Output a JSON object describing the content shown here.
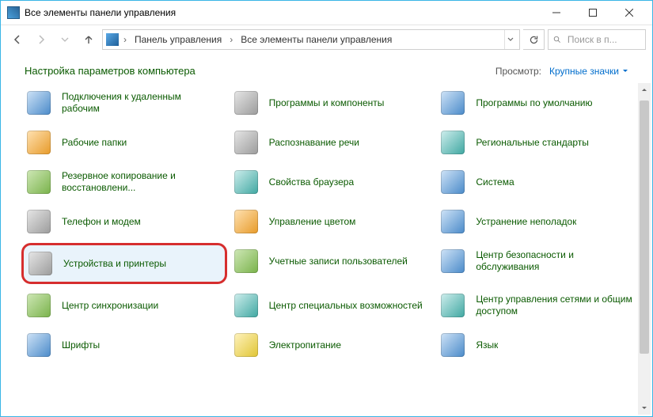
{
  "window": {
    "title": "Все элементы панели управления"
  },
  "breadcrumb": {
    "segments": [
      "Панель управления",
      "Все элементы панели управления"
    ]
  },
  "search": {
    "placeholder": "Поиск в п..."
  },
  "header": {
    "heading": "Настройка параметров компьютера",
    "view_label": "Просмотр:",
    "view_value": "Крупные значки"
  },
  "items": [
    {
      "label": "Подключения к удаленным рабочим",
      "icon": "blue",
      "highlight": false
    },
    {
      "label": "Программы и компоненты",
      "icon": "gray",
      "highlight": false
    },
    {
      "label": "Программы по умолчанию",
      "icon": "blue",
      "highlight": false
    },
    {
      "label": "Рабочие папки",
      "icon": "orange",
      "highlight": false
    },
    {
      "label": "Распознавание речи",
      "icon": "gray",
      "highlight": false
    },
    {
      "label": "Региональные стандарты",
      "icon": "teal",
      "highlight": false
    },
    {
      "label": "Резервное копирование и восстановлени...",
      "icon": "green",
      "highlight": false
    },
    {
      "label": "Свойства браузера",
      "icon": "teal",
      "highlight": false
    },
    {
      "label": "Система",
      "icon": "blue",
      "highlight": false
    },
    {
      "label": "Телефон и модем",
      "icon": "gray",
      "highlight": false
    },
    {
      "label": "Управление цветом",
      "icon": "orange",
      "highlight": false
    },
    {
      "label": "Устранение неполадок",
      "icon": "blue",
      "highlight": false
    },
    {
      "label": "Устройства и принтеры",
      "icon": "gray",
      "highlight": true
    },
    {
      "label": "Учетные записи пользователей",
      "icon": "green",
      "highlight": false
    },
    {
      "label": "Центр безопасности и обслуживания",
      "icon": "blue",
      "highlight": false
    },
    {
      "label": "Центр синхронизации",
      "icon": "green",
      "highlight": false
    },
    {
      "label": "Центр специальных возможностей",
      "icon": "teal",
      "highlight": false
    },
    {
      "label": "Центр управления сетями и общим доступом",
      "icon": "teal",
      "highlight": false
    },
    {
      "label": "Шрифты",
      "icon": "blue",
      "highlight": false
    },
    {
      "label": "Электропитание",
      "icon": "yellow",
      "highlight": false
    },
    {
      "label": "Язык",
      "icon": "blue",
      "highlight": false
    }
  ]
}
